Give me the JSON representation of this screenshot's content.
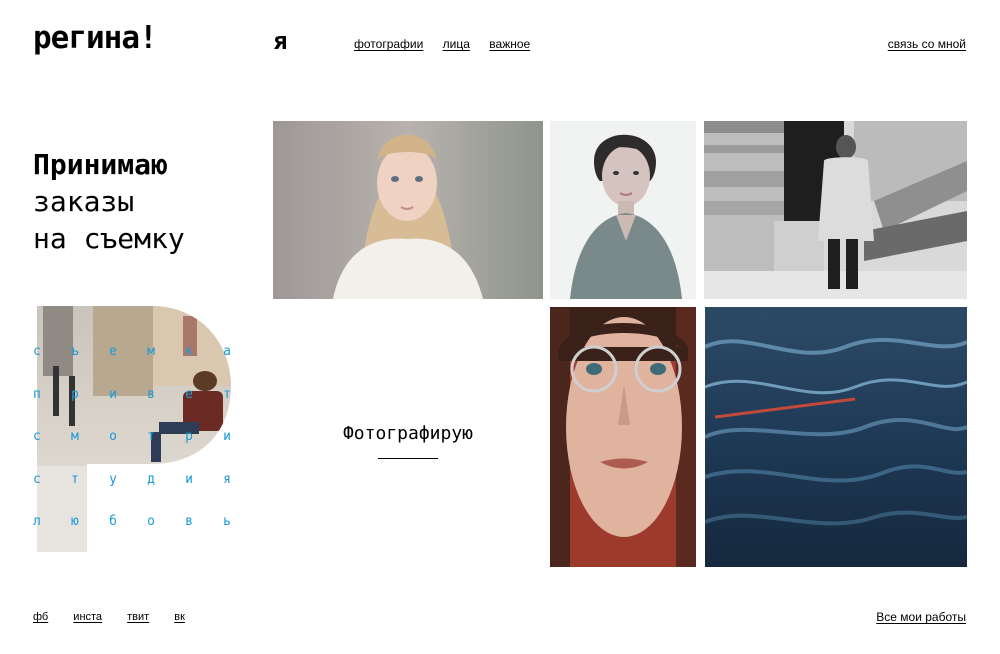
{
  "header": {
    "logo": "регина!",
    "ya": "я",
    "nav": [
      "фотографии",
      "лица",
      "важное"
    ],
    "contact": "связь со мной"
  },
  "hero": {
    "line1": "Принимаю",
    "line2": "заказы",
    "line3": "на съемку"
  },
  "letter_block": {
    "letter": "Р",
    "accent": "#1a9bd7",
    "rows": [
      [
        "с",
        "ъ",
        "е",
        "м",
        "к",
        "а"
      ],
      [
        "п",
        "р",
        "и",
        "в",
        "е",
        "т"
      ],
      [
        "с",
        "м",
        "о",
        "т",
        "р",
        "и"
      ],
      [
        "с",
        "т",
        "у",
        "д",
        "и",
        "я"
      ],
      [
        "л",
        "ю",
        "б",
        "о",
        "в",
        "ь"
      ]
    ]
  },
  "gallery": {
    "caption": "Фотографирую",
    "photos": [
      {
        "subject": "blonde-girl-portrait"
      },
      {
        "subject": "woman-portrait-bw"
      },
      {
        "subject": "old-man-on-steps"
      },
      {
        "subject": "woman-with-glasses-closeup"
      },
      {
        "subject": "dark-water-waves"
      }
    ]
  },
  "footer": {
    "social": [
      "фб",
      "инста",
      "твит",
      "вк"
    ],
    "all_works": "Все мои работы"
  }
}
